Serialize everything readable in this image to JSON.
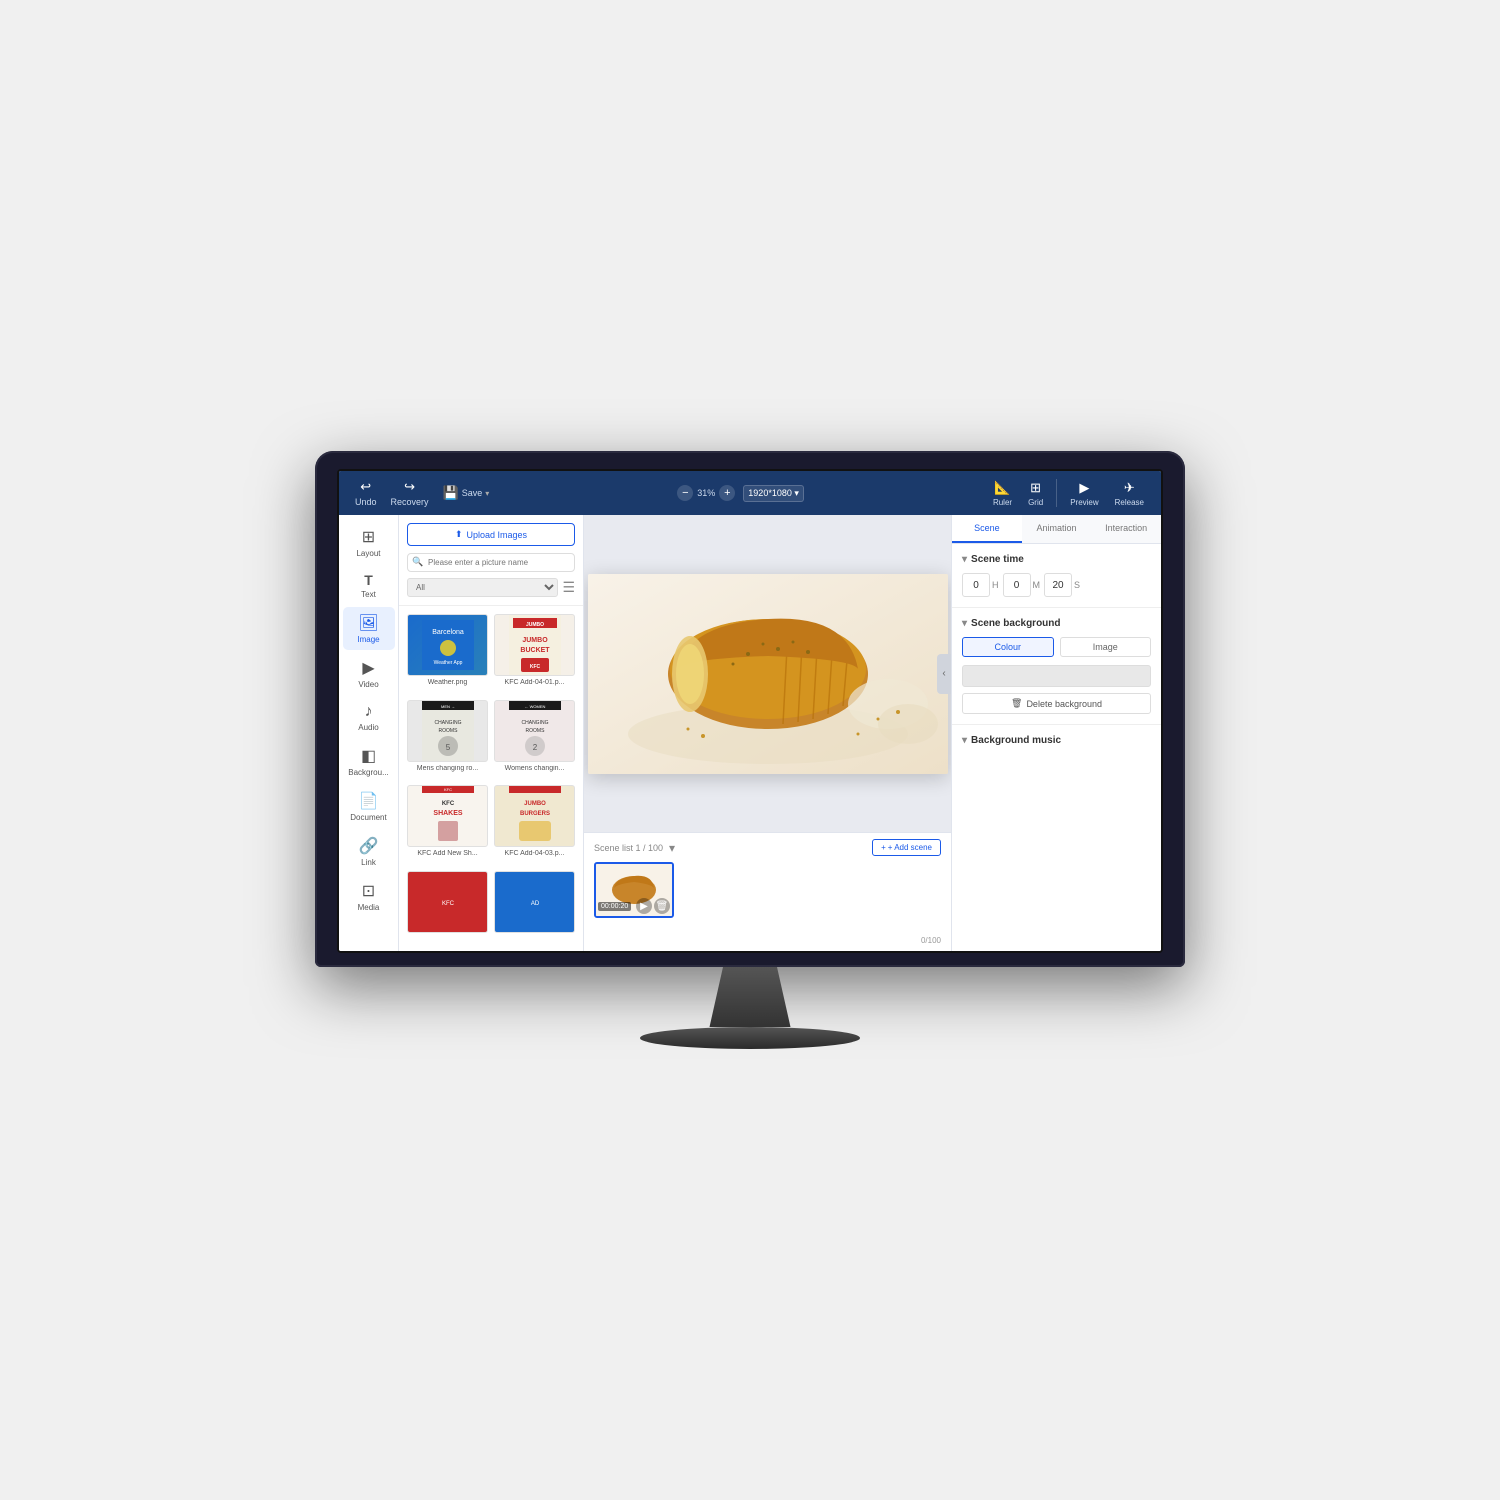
{
  "topbar": {
    "undo_label": "Undo",
    "recovery_label": "Recovery",
    "save_label": "Save",
    "zoom_percent": "31%",
    "resolution": "1920*1080",
    "ruler_label": "Ruler",
    "grid_label": "Grid",
    "preview_label": "Preview",
    "release_label": "Release"
  },
  "sidebar": {
    "items": [
      {
        "id": "layout",
        "label": "Layout",
        "icon": "⊞"
      },
      {
        "id": "text",
        "label": "Text",
        "icon": "T"
      },
      {
        "id": "image",
        "label": "Image",
        "icon": "🖼"
      },
      {
        "id": "video",
        "label": "Video",
        "icon": "▶"
      },
      {
        "id": "audio",
        "label": "Audio",
        "icon": "♪"
      },
      {
        "id": "background",
        "label": "Backgrou...",
        "icon": "◧"
      },
      {
        "id": "document",
        "label": "Document",
        "icon": "📄"
      },
      {
        "id": "link",
        "label": "Link",
        "icon": "🔗"
      },
      {
        "id": "media",
        "label": "Media",
        "icon": "⊡"
      }
    ]
  },
  "images_panel": {
    "upload_label": "Upload Images",
    "search_placeholder": "Please enter a picture name",
    "filter_option": "All",
    "images": [
      {
        "id": "weather",
        "name": "Weather.png",
        "type": "weather"
      },
      {
        "id": "kfc1",
        "name": "KFC Add-04-01.p...",
        "type": "kfc1"
      },
      {
        "id": "mens",
        "name": "Mens changing ro...",
        "type": "mens"
      },
      {
        "id": "womens",
        "name": "Womens changin...",
        "type": "womens"
      },
      {
        "id": "shakes",
        "name": "KFC Add New Sh...",
        "type": "shakes"
      },
      {
        "id": "kfc3",
        "name": "KFC Add-04-03.p...",
        "type": "kfc3"
      },
      {
        "id": "red1",
        "name": "",
        "type": "red1"
      },
      {
        "id": "blue1",
        "name": "",
        "type": "blue1"
      }
    ]
  },
  "canvas": {
    "alt_text": "Bread photo with grains on white background"
  },
  "scene_timeline": {
    "count_label": "Scene list 1 / 100",
    "add_scene_label": "+ Add scene",
    "scene_1": {
      "time": "00:00:20"
    },
    "page_counter": "0/100"
  },
  "right_panel": {
    "tabs": [
      "Scene",
      "Animation",
      "Interaction"
    ],
    "active_tab": "Scene",
    "scene_time": {
      "title": "Scene time",
      "h_value": "0",
      "h_label": "H",
      "m_value": "0",
      "m_label": "M",
      "s_value": "20",
      "s_label": "S"
    },
    "scene_background": {
      "title": "Scene background",
      "colour_tab": "Colour",
      "image_tab": "Image",
      "delete_bg_label": "Delete background"
    },
    "background_music": {
      "title": "Background music"
    }
  },
  "icons": {
    "undo": "↩",
    "redo": "↪",
    "save": "💾",
    "ruler": "📏",
    "grid": "⊞",
    "preview": "▶",
    "release": "✈",
    "upload": "⬆",
    "search": "🔍",
    "menu": "☰",
    "chevron_left": "‹",
    "plus": "+",
    "play": "▶",
    "trash": "🗑",
    "triangle_down": "▾",
    "section_toggle": "▾",
    "delete_bg": "🗑"
  }
}
